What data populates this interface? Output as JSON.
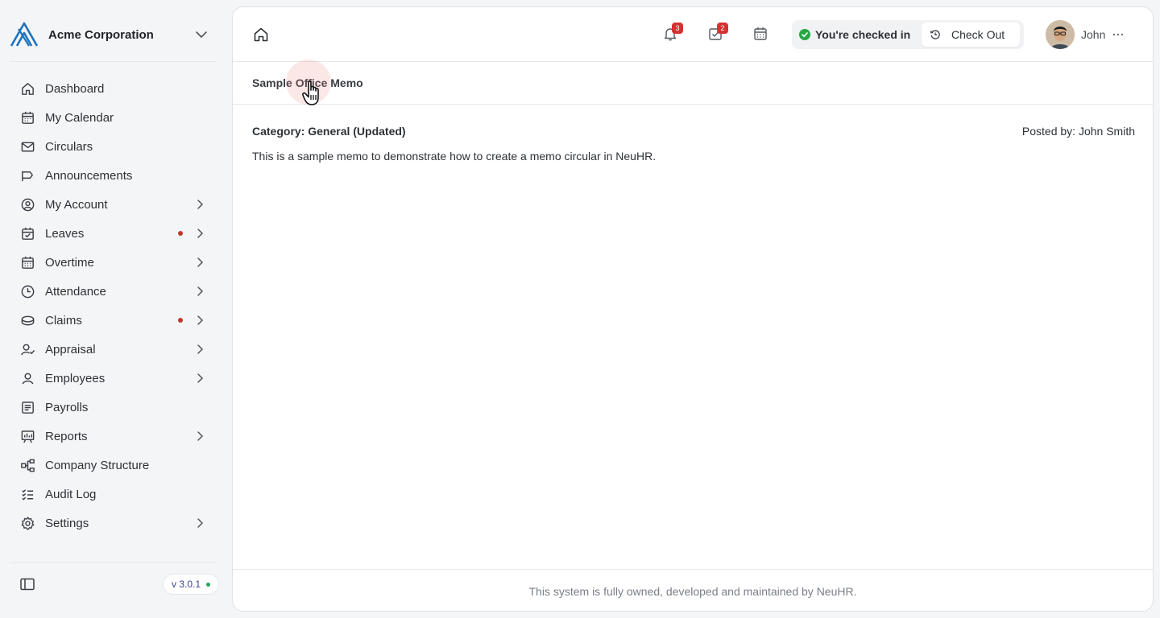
{
  "sidebar": {
    "org_name": "Acme Corporation",
    "items": [
      {
        "label": "Dashboard"
      },
      {
        "label": "My Calendar"
      },
      {
        "label": "Circulars"
      },
      {
        "label": "Announcements"
      },
      {
        "label": "My Account"
      },
      {
        "label": "Leaves"
      },
      {
        "label": "Overtime"
      },
      {
        "label": "Attendance"
      },
      {
        "label": "Claims"
      },
      {
        "label": "Appraisal"
      },
      {
        "label": "Employees"
      },
      {
        "label": "Payrolls"
      },
      {
        "label": "Reports"
      },
      {
        "label": "Company Structure"
      },
      {
        "label": "Audit Log"
      },
      {
        "label": "Settings"
      }
    ],
    "version": "v 3.0.1"
  },
  "topbar": {
    "notifications_count": "3",
    "tasks_count": "2",
    "checkin_status": "You're checked in",
    "checkout_label": "Check Out",
    "user_name": "John"
  },
  "memo": {
    "title": "Sample Office Memo",
    "category": "Category: General (Updated)",
    "posted_by": "Posted by: John Smith",
    "body": "This is a sample memo to demonstrate how to create a memo circular in NeuHR."
  },
  "footer": {
    "text": "This system is fully owned, developed and maintained by NeuHR."
  },
  "colors": {
    "accent_logo": "#1e73be",
    "badge": "#d63031",
    "alert_dot": "#c0392b",
    "checked_in": "#28a745",
    "version_dot": "#22a55b"
  }
}
